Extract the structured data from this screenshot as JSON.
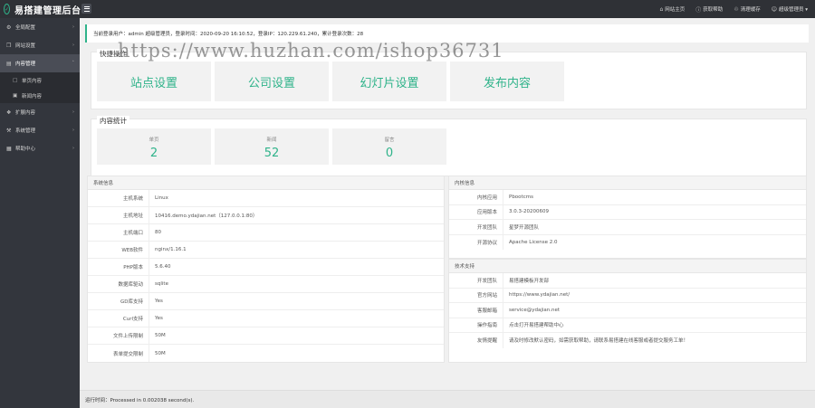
{
  "header": {
    "logo_glyph": "✓",
    "title": "易搭建管理后台",
    "links": [
      {
        "icon": "home-icon",
        "glyph": "⌂",
        "label": "网站主页"
      },
      {
        "icon": "help-icon",
        "glyph": "ⓘ",
        "label": "获取帮助"
      },
      {
        "icon": "trash-icon",
        "glyph": "♲",
        "label": "清理缓存"
      },
      {
        "icon": "user-icon",
        "glyph": "☺",
        "label": "超级管理员 ▾"
      }
    ]
  },
  "sidebar": {
    "items": [
      {
        "icon": "gear-icon",
        "glyph": "⚙",
        "label": "全局配置",
        "arrow": "›"
      },
      {
        "icon": "site-icon",
        "glyph": "❐",
        "label": "网站设置",
        "arrow": "›"
      },
      {
        "icon": "folder-icon",
        "glyph": "▤",
        "label": "内容管理",
        "arrow": "˄"
      },
      {
        "icon": "puzzle-icon",
        "glyph": "❖",
        "label": "扩展内容",
        "arrow": "›"
      },
      {
        "icon": "tools-icon",
        "glyph": "⚒",
        "label": "系统管理",
        "arrow": "›"
      },
      {
        "icon": "book-icon",
        "glyph": "▦",
        "label": "帮助中心",
        "arrow": "›"
      }
    ],
    "sub_items": [
      {
        "icon": "page-icon",
        "glyph": "□",
        "label": "单页内容"
      },
      {
        "icon": "list-icon",
        "glyph": "▣",
        "label": "新闻内容"
      }
    ]
  },
  "info_bar": "当前登录用户：admin 超级管理员，登录时间：2020-09-20 16:10:52，登录IP：120.229.61.240，累计登录次数：28",
  "watermark": "https://www.huzhan.com/ishop36731",
  "quick": {
    "title": "快捷操作",
    "buttons": [
      "站点设置",
      "公司设置",
      "幻灯片设置",
      "发布内容"
    ]
  },
  "stats": {
    "title": "内容统计",
    "boxes": [
      {
        "label": "单页",
        "value": "2"
      },
      {
        "label": "新闻",
        "value": "52"
      },
      {
        "label": "留言",
        "value": "0"
      }
    ]
  },
  "system": {
    "title": "系统信息",
    "rows": [
      {
        "k": "主机系统",
        "v": "Linux"
      },
      {
        "k": "主机地址",
        "v": "10416.demo.ydajian.net（127.0.0.1:80）"
      },
      {
        "k": "主机端口",
        "v": "80"
      },
      {
        "k": "WEB软件",
        "v": "nginx/1.16.1"
      },
      {
        "k": "PHP版本",
        "v": "5.6.40"
      },
      {
        "k": "数据库驱动",
        "v": "sqlite"
      },
      {
        "k": "GD库支持",
        "v": "Yes"
      },
      {
        "k": "Curl支持",
        "v": "Yes"
      },
      {
        "k": "文件上传限制",
        "v": "50M"
      },
      {
        "k": "表单提交限制",
        "v": "50M"
      }
    ]
  },
  "cms": {
    "title": "内核信息",
    "rows": [
      {
        "k": "内核应用",
        "v": "Pbootcms"
      },
      {
        "k": "应用版本",
        "v": "3.0.3-20200609"
      },
      {
        "k": "开发团队",
        "v": "星梦开源团队"
      },
      {
        "k": "开源协议",
        "v": "Apache License 2.0"
      }
    ]
  },
  "tech": {
    "title": "技术支持",
    "rows": [
      {
        "k": "开发团队",
        "v": "易搭建模板开发部"
      },
      {
        "k": "官方网站",
        "v": "https://www.ydajian.net/"
      },
      {
        "k": "客服邮箱",
        "v": "service@ydajian.net"
      },
      {
        "k": "操作指南",
        "v": "点击打开易搭建帮助中心"
      },
      {
        "k": "友情提醒",
        "v": "请及时修改默认密码，如需获取帮助，请联系易搭建在线客服或者提交服务工单！"
      }
    ]
  },
  "footer": "运行时间：Processed in 0.002038 second(s)."
}
